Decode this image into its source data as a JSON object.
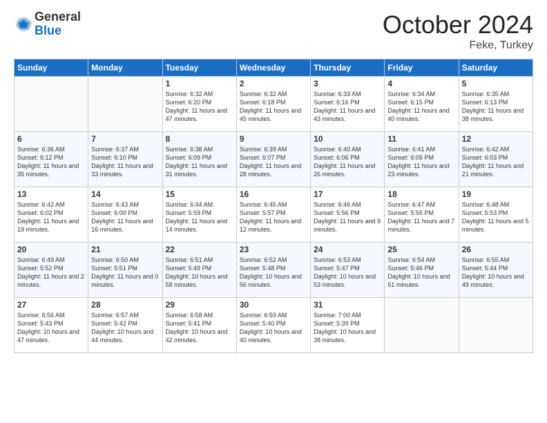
{
  "header": {
    "logo_line1": "General",
    "logo_line2": "Blue",
    "month": "October 2024",
    "location": "Feke, Turkey"
  },
  "weekdays": [
    "Sunday",
    "Monday",
    "Tuesday",
    "Wednesday",
    "Thursday",
    "Friday",
    "Saturday"
  ],
  "weeks": [
    [
      {
        "day": "",
        "sunrise": "",
        "sunset": "",
        "daylight": ""
      },
      {
        "day": "",
        "sunrise": "",
        "sunset": "",
        "daylight": ""
      },
      {
        "day": "1",
        "sunrise": "Sunrise: 6:32 AM",
        "sunset": "Sunset: 6:20 PM",
        "daylight": "Daylight: 11 hours and 47 minutes."
      },
      {
        "day": "2",
        "sunrise": "Sunrise: 6:32 AM",
        "sunset": "Sunset: 6:18 PM",
        "daylight": "Daylight: 11 hours and 45 minutes."
      },
      {
        "day": "3",
        "sunrise": "Sunrise: 6:33 AM",
        "sunset": "Sunset: 6:16 PM",
        "daylight": "Daylight: 11 hours and 43 minutes."
      },
      {
        "day": "4",
        "sunrise": "Sunrise: 6:34 AM",
        "sunset": "Sunset: 6:15 PM",
        "daylight": "Daylight: 11 hours and 40 minutes."
      },
      {
        "day": "5",
        "sunrise": "Sunrise: 6:35 AM",
        "sunset": "Sunset: 6:13 PM",
        "daylight": "Daylight: 11 hours and 38 minutes."
      }
    ],
    [
      {
        "day": "6",
        "sunrise": "Sunrise: 6:36 AM",
        "sunset": "Sunset: 6:12 PM",
        "daylight": "Daylight: 11 hours and 35 minutes."
      },
      {
        "day": "7",
        "sunrise": "Sunrise: 6:37 AM",
        "sunset": "Sunset: 6:10 PM",
        "daylight": "Daylight: 11 hours and 33 minutes."
      },
      {
        "day": "8",
        "sunrise": "Sunrise: 6:38 AM",
        "sunset": "Sunset: 6:09 PM",
        "daylight": "Daylight: 11 hours and 31 minutes."
      },
      {
        "day": "9",
        "sunrise": "Sunrise: 6:39 AM",
        "sunset": "Sunset: 6:07 PM",
        "daylight": "Daylight: 11 hours and 28 minutes."
      },
      {
        "day": "10",
        "sunrise": "Sunrise: 6:40 AM",
        "sunset": "Sunset: 6:06 PM",
        "daylight": "Daylight: 11 hours and 26 minutes."
      },
      {
        "day": "11",
        "sunrise": "Sunrise: 6:41 AM",
        "sunset": "Sunset: 6:05 PM",
        "daylight": "Daylight: 11 hours and 23 minutes."
      },
      {
        "day": "12",
        "sunrise": "Sunrise: 6:42 AM",
        "sunset": "Sunset: 6:03 PM",
        "daylight": "Daylight: 11 hours and 21 minutes."
      }
    ],
    [
      {
        "day": "13",
        "sunrise": "Sunrise: 6:42 AM",
        "sunset": "Sunset: 6:02 PM",
        "daylight": "Daylight: 11 hours and 19 minutes."
      },
      {
        "day": "14",
        "sunrise": "Sunrise: 6:43 AM",
        "sunset": "Sunset: 6:00 PM",
        "daylight": "Daylight: 11 hours and 16 minutes."
      },
      {
        "day": "15",
        "sunrise": "Sunrise: 6:44 AM",
        "sunset": "Sunset: 5:59 PM",
        "daylight": "Daylight: 11 hours and 14 minutes."
      },
      {
        "day": "16",
        "sunrise": "Sunrise: 6:45 AM",
        "sunset": "Sunset: 5:57 PM",
        "daylight": "Daylight: 11 hours and 12 minutes."
      },
      {
        "day": "17",
        "sunrise": "Sunrise: 6:46 AM",
        "sunset": "Sunset: 5:56 PM",
        "daylight": "Daylight: 11 hours and 9 minutes."
      },
      {
        "day": "18",
        "sunrise": "Sunrise: 6:47 AM",
        "sunset": "Sunset: 5:55 PM",
        "daylight": "Daylight: 11 hours and 7 minutes."
      },
      {
        "day": "19",
        "sunrise": "Sunrise: 6:48 AM",
        "sunset": "Sunset: 5:53 PM",
        "daylight": "Daylight: 11 hours and 5 minutes."
      }
    ],
    [
      {
        "day": "20",
        "sunrise": "Sunrise: 6:49 AM",
        "sunset": "Sunset: 5:52 PM",
        "daylight": "Daylight: 11 hours and 2 minutes."
      },
      {
        "day": "21",
        "sunrise": "Sunrise: 6:50 AM",
        "sunset": "Sunset: 5:51 PM",
        "daylight": "Daylight: 11 hours and 0 minutes."
      },
      {
        "day": "22",
        "sunrise": "Sunrise: 6:51 AM",
        "sunset": "Sunset: 5:49 PM",
        "daylight": "Daylight: 10 hours and 58 minutes."
      },
      {
        "day": "23",
        "sunrise": "Sunrise: 6:52 AM",
        "sunset": "Sunset: 5:48 PM",
        "daylight": "Daylight: 10 hours and 56 minutes."
      },
      {
        "day": "24",
        "sunrise": "Sunrise: 6:53 AM",
        "sunset": "Sunset: 5:47 PM",
        "daylight": "Daylight: 10 hours and 53 minutes."
      },
      {
        "day": "25",
        "sunrise": "Sunrise: 6:54 AM",
        "sunset": "Sunset: 5:46 PM",
        "daylight": "Daylight: 10 hours and 51 minutes."
      },
      {
        "day": "26",
        "sunrise": "Sunrise: 6:55 AM",
        "sunset": "Sunset: 5:44 PM",
        "daylight": "Daylight: 10 hours and 49 minutes."
      }
    ],
    [
      {
        "day": "27",
        "sunrise": "Sunrise: 6:56 AM",
        "sunset": "Sunset: 5:43 PM",
        "daylight": "Daylight: 10 hours and 47 minutes."
      },
      {
        "day": "28",
        "sunrise": "Sunrise: 6:57 AM",
        "sunset": "Sunset: 5:42 PM",
        "daylight": "Daylight: 10 hours and 44 minutes."
      },
      {
        "day": "29",
        "sunrise": "Sunrise: 6:58 AM",
        "sunset": "Sunset: 5:41 PM",
        "daylight": "Daylight: 10 hours and 42 minutes."
      },
      {
        "day": "30",
        "sunrise": "Sunrise: 6:59 AM",
        "sunset": "Sunset: 5:40 PM",
        "daylight": "Daylight: 10 hours and 40 minutes."
      },
      {
        "day": "31",
        "sunrise": "Sunrise: 7:00 AM",
        "sunset": "Sunset: 5:39 PM",
        "daylight": "Daylight: 10 hours and 38 minutes."
      },
      {
        "day": "",
        "sunrise": "",
        "sunset": "",
        "daylight": ""
      },
      {
        "day": "",
        "sunrise": "",
        "sunset": "",
        "daylight": ""
      }
    ]
  ]
}
